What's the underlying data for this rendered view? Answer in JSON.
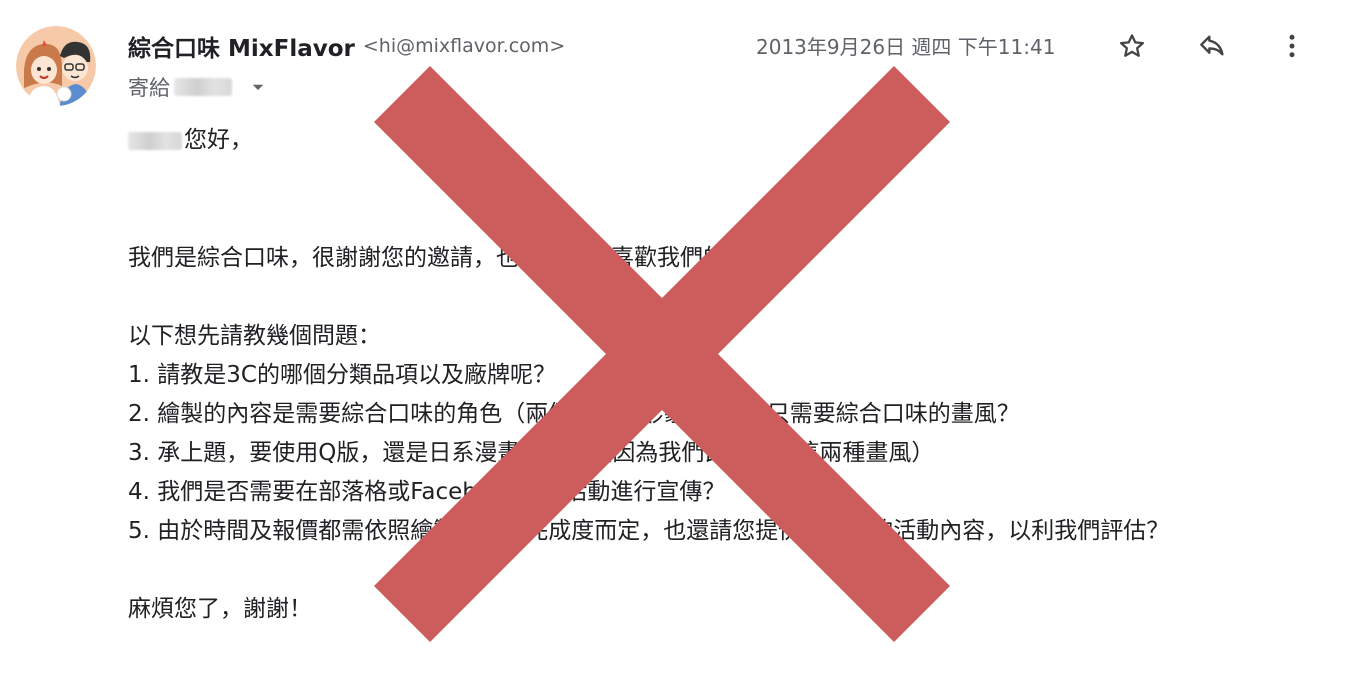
{
  "header": {
    "sender_name": "綜合口味 MixFlavor",
    "sender_email": "<hi@mixflavor.com>",
    "date": "2013年9月26日 週四 下午11:41",
    "to_label": "寄給"
  },
  "icons": {
    "avatar": "avatar-illustration",
    "star": "star-icon",
    "reply": "reply-icon",
    "more": "more-vert-icon",
    "recipient_caret": "chevron-down-icon",
    "overlay": "red-x-mark"
  },
  "body": {
    "greeting": "您好，",
    "intro": "我們是綜合口味，很謝謝您的邀請，也很高興您喜歡我們的圖 :)",
    "question_lead": "以下想先請教幾個問題：",
    "questions": [
      "1. 請教是3C的哪個分類品項以及廠牌呢？",
      "2. 繪製的內容是需要綜合口味的角色（兩個人物的形象），還是只需要綜合口味的畫風？",
      "3. 承上題，要使用Q版，還是日系漫畫風格？（因為我們比較常用這兩種畫風）",
      "4. 我們是否需要在部落格或Facebook上對活動進行宣傳？",
      "5. 由於時間及報價都需依照繪製內容及完成度而定，也還請您提供更具體的活動內容，以利我們評估？"
    ],
    "closing": "麻煩您了，謝謝！"
  },
  "colors": {
    "overlay_red": "#cd5c5c",
    "text_primary": "#202124",
    "text_secondary": "#5f6368"
  }
}
